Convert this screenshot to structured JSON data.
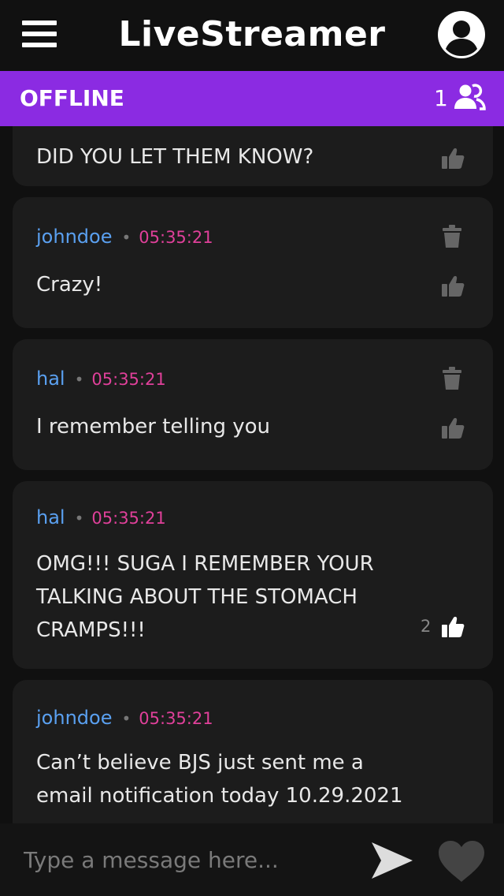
{
  "header": {
    "title": "LiveStreamer",
    "menu_icon": "menu-icon",
    "profile_icon": "user-circle-icon"
  },
  "status": {
    "label": "OFFLINE",
    "viewer_count": "1",
    "viewers_icon": "users-icon",
    "background": "#8b2be2"
  },
  "messages": [
    {
      "text": "DID YOU LET THEM KNOW?"
    },
    {
      "username": "johndoe",
      "time": "05:35:21",
      "text": "Crazy!"
    },
    {
      "username": "hal",
      "time": "05:35:21",
      "text": "I remember telling you"
    },
    {
      "username": "hal",
      "time": "05:35:21",
      "text_lines": [
        "OMG!!! SUGA I REMEMBER YOUR",
        "TALKING ABOUT THE STOMACH",
        "CRAMPS!!!"
      ],
      "likes": "2"
    },
    {
      "username": "johndoe",
      "time": "05:35:21",
      "text_lines": [
        "Can’t believe BJS just sent me a",
        "email notification today 10.29.2021"
      ]
    }
  ],
  "composer": {
    "placeholder": "Type a message here...",
    "send_icon": "send-icon",
    "heart_icon": "heart-icon"
  },
  "colors": {
    "username": "#5aa0f0",
    "timestamp": "#e0409a",
    "card": "#1c1c1c",
    "background": "#101010"
  }
}
